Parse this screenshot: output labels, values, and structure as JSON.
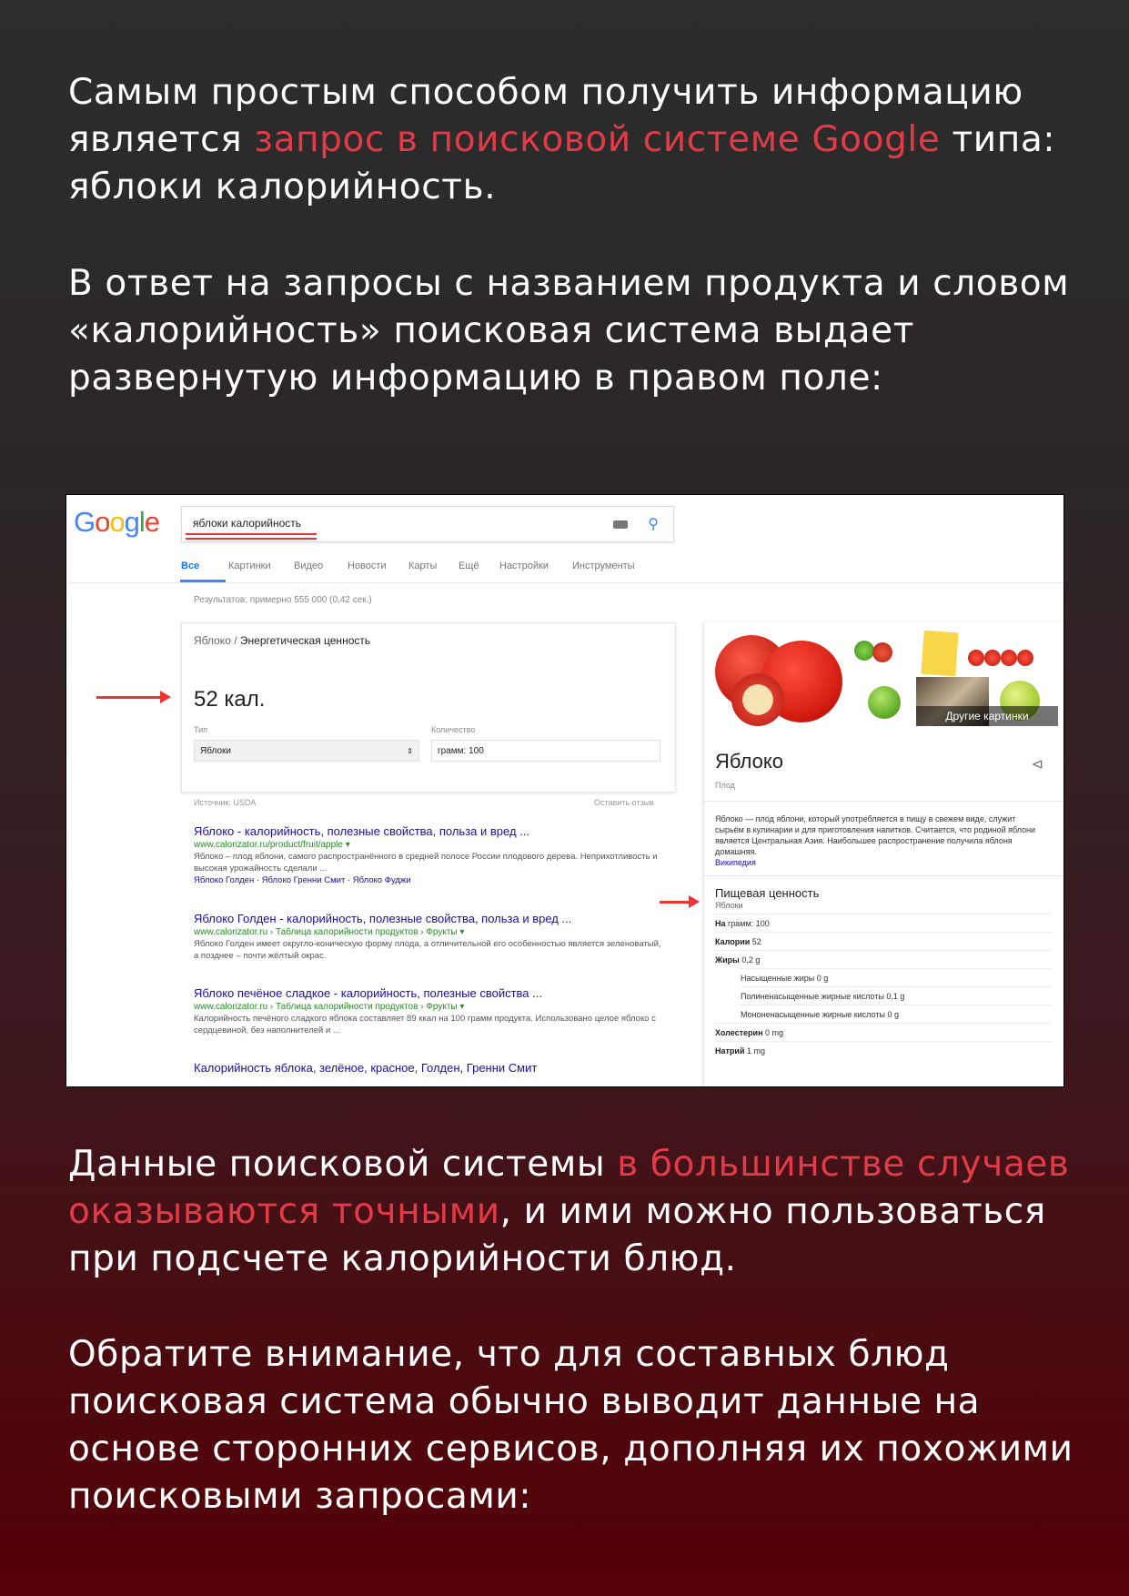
{
  "text": {
    "p1": {
      "a": "Самым простым способом получить информацию является ",
      "b": "запрос в поисковой системе Google",
      "c": " типа: яблоки калорийность."
    },
    "p2": "В ответ на запросы с названием продукта и словом «калорийность» поисковая система выдает развернутую информацию в правом поле:",
    "p3": {
      "a": "Данные поисковой системы ",
      "b": "в большинстве случаев оказываются точными",
      "c": ", и ими можно пользоваться при подсчете калорийности блюд."
    },
    "p4": "Обратите внимание, что для составных блюд поисковая система обычно выводит данные на основе сторонних сервисов, дополняя их похожими поисковыми запросами:"
  },
  "screenshot": {
    "logo": [
      "G",
      "o",
      "o",
      "g",
      "l",
      "e"
    ],
    "logo_colors": [
      "#4285f4",
      "#ea4335",
      "#fbbc05",
      "#4285f4",
      "#34a853",
      "#ea4335"
    ],
    "query": "яблоки калорийность",
    "tabs": [
      "Все",
      "Картинки",
      "Видео",
      "Новости",
      "Карты",
      "Ещё",
      "Настройки",
      "Инструменты"
    ],
    "results_count": "Результатов: примерно 555 000 (0,42 сек.)",
    "card": {
      "crumb_a": "Яблоко",
      "crumb_sep": " / ",
      "crumb_b": "Энергетическая ценность",
      "kcal": "52 кал.",
      "type_label": "Тип",
      "type_value": "Яблоки",
      "qty_label": "Количество",
      "qty_value": "грамм: 100"
    },
    "source": "Источник: USDA",
    "feedback": "Оставить отзыв",
    "results": [
      {
        "title": "Яблоко - калорийность, полезные свойства, польза и вред ...",
        "url": "www.calorizator.ru/product/fruit/apple ▾",
        "snippet": "Яблоко – плод яблони, самого распространённого в средней полосе России плодового дерева. Неприхотливость и высокая урожайность сделали ...",
        "links": "Яблоко Голден · Яблоко Гренни Смит · Яблоко Фуджи"
      },
      {
        "title": "Яблоко Голден - калорийность, полезные свойства, польза и вред ...",
        "url": "www.calorizator.ru › Таблица калорийности продуктов › Фрукты ▾",
        "snippet": "Яблоко Голден имеет округло-коническую форму плода, а отличительной его особенностью является зеленоватый, а позднее – почти жёлтый окрас."
      },
      {
        "title": "Яблоко печёное сладкое - калорийность, полезные свойства ...",
        "url": "www.calorizator.ru › Таблица калорийности продуктов › Фрукты ▾",
        "snippet": "Калорийность печёного сладкого яблока составляет 89 ккал на 100 грамм продукта. Использовано целое яблоко с сердцевиной, без наполнителей и ..."
      },
      {
        "title": "Калорийность яблока, зелёное, красное, Голден, Гренни Смит"
      }
    ],
    "panel": {
      "more_pictures": "Другие картинки",
      "title": "Яблоко",
      "subtitle": "Плод",
      "description": "Яблоко — плод яблони, который употребляется в пищу в свежем виде, служит сырьём в кулинарии и для приготовления напитков. Считается, что родиной яблони является Центральная Азия. Наибольшее распространение получила яблоня домашняя.",
      "wiki": "Википедия",
      "nutrition_title": "Пищевая ценность",
      "nutrition_sub": "Яблоки",
      "rows": [
        {
          "label": "На",
          "value": " грамм: 100"
        },
        {
          "label": "Калории",
          "value": " 52"
        },
        {
          "label": "Жиры",
          "value": " 0,2 g"
        },
        {
          "label": "",
          "value": "Насыщенные жиры 0 g"
        },
        {
          "label": "",
          "value": "Полиненасыщенные жирные кислоты 0,1 g"
        },
        {
          "label": "",
          "value": "Мононенасыщенные жирные кислоты 0 g"
        },
        {
          "label": "Холестерин",
          "value": " 0 mg"
        },
        {
          "label": "Натрий",
          "value": " 1 mg"
        }
      ]
    }
  }
}
